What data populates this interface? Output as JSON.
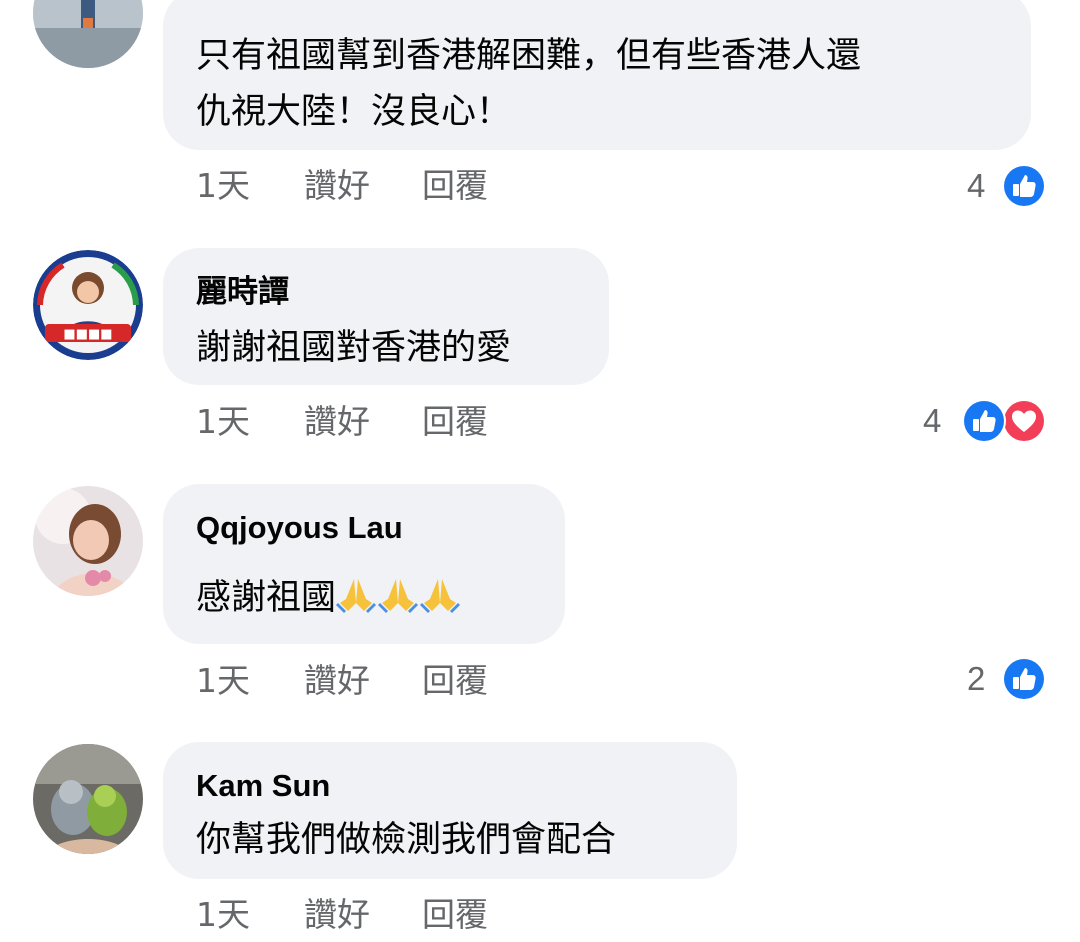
{
  "comments": [
    {
      "author": "",
      "text_line1": "只有祖國幫到香港解困難，但有些香港人還",
      "text_line2": "仇視大陸！沒良心！",
      "time": "1天",
      "like_label": "讚好",
      "reply_label": "回覆",
      "reaction_count": "4",
      "reactions": [
        "like-icon"
      ]
    },
    {
      "author": "麗時譚",
      "text": "謝謝祖國對香港的愛",
      "time": "1天",
      "like_label": "讚好",
      "reply_label": "回覆",
      "reaction_count": "4",
      "reactions": [
        "like-icon",
        "love-icon"
      ]
    },
    {
      "author": "Qqjoyous Lau",
      "text": "感謝祖國",
      "emoji": [
        "folded-hands",
        "folded-hands",
        "folded-hands"
      ],
      "time": "1天",
      "like_label": "讚好",
      "reply_label": "回覆",
      "reaction_count": "2",
      "reactions": [
        "like-icon"
      ]
    },
    {
      "author": "Kam Sun",
      "text": "你幫我們做檢測我們會配合",
      "time": "1天",
      "like_label": "讚好",
      "reply_label": "回覆"
    }
  ],
  "colors": {
    "bubble": "#f0f2f5",
    "meta_text": "#65676b",
    "like_blue": "#1877f2",
    "love_red": "#f33e58"
  }
}
